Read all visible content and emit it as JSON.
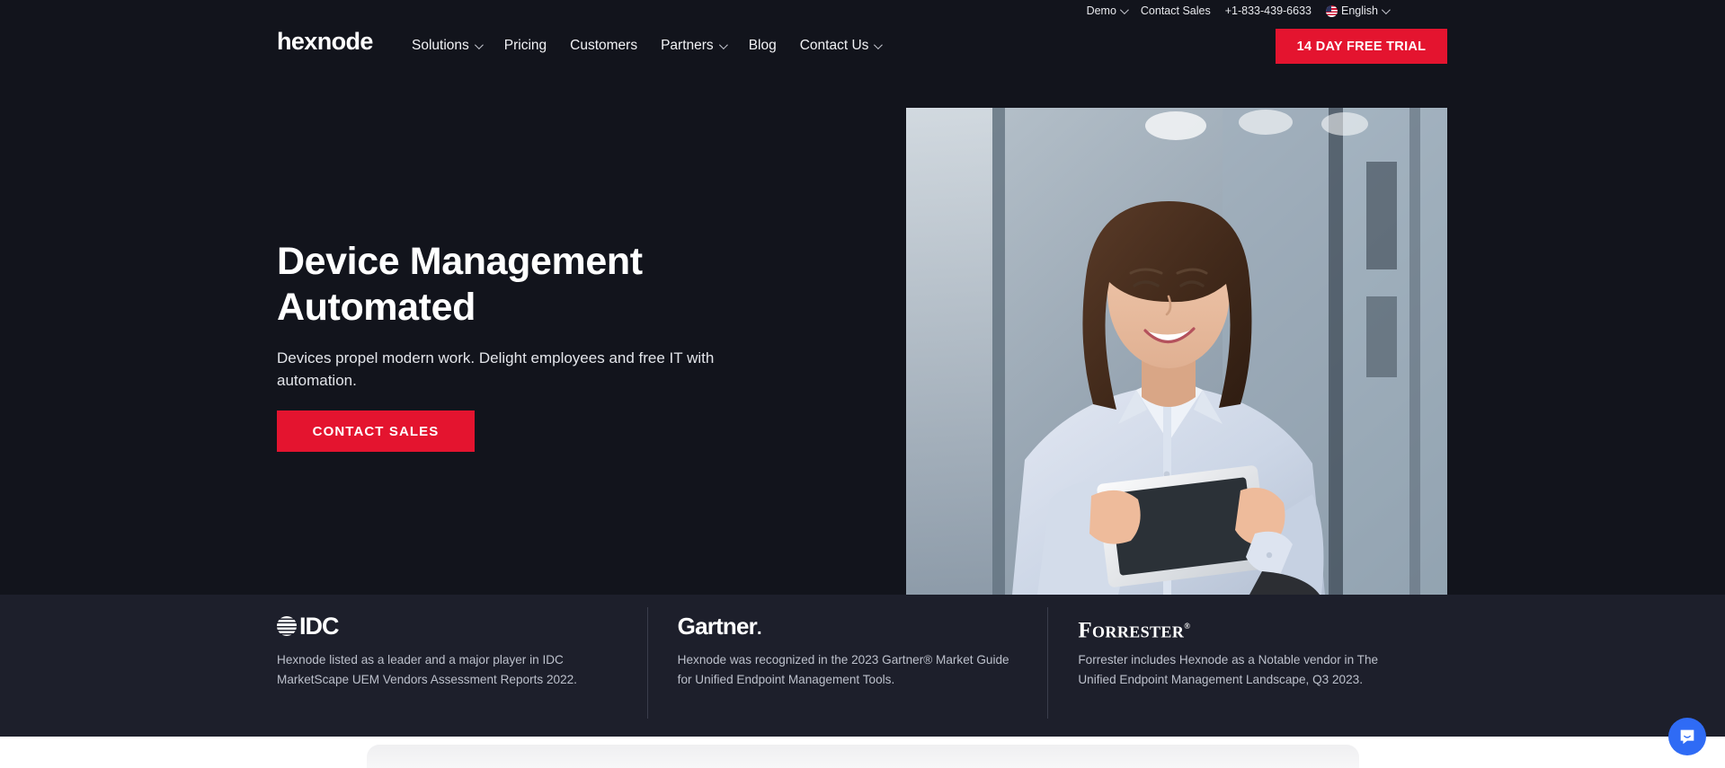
{
  "topbar": {
    "items": [
      {
        "label": "Demo",
        "caret": true,
        "icon": null
      },
      {
        "label": "Contact Sales",
        "caret": false,
        "icon": null
      },
      {
        "label": "+1-833-439-6633",
        "caret": false,
        "icon": null
      },
      {
        "label": "English",
        "caret": true,
        "icon": "us-flag-icon"
      }
    ]
  },
  "brand": {
    "logo_text": "hexnode",
    "accent_color": "#e4142f"
  },
  "nav": {
    "items": [
      {
        "label": "Solutions",
        "caret": true
      },
      {
        "label": "Pricing",
        "caret": false
      },
      {
        "label": "Customers",
        "caret": false
      },
      {
        "label": "Partners",
        "caret": true
      },
      {
        "label": "Blog",
        "caret": false
      },
      {
        "label": "Contact Us",
        "caret": true
      }
    ],
    "trial_button": "14 DAY FREE TRIAL"
  },
  "hero": {
    "heading_line1": "Device Management",
    "heading_line2": "Automated",
    "subheading": "Devices propel modern work. Delight employees and free IT with automation.",
    "cta_label": "CONTACT SALES",
    "image_alt": "smiling-woman-holding-tablet-in-office"
  },
  "analysts": [
    {
      "logo_name": "idc-logo",
      "logo_text": "IDC",
      "text": "Hexnode listed as a leader and a major player in IDC MarketScape UEM Vendors Assessment Reports 2022."
    },
    {
      "logo_name": "gartner-logo",
      "logo_text": "Gartner",
      "text": "Hexnode was recognized in the 2023 Gartner® Market Guide for Unified Endpoint Management Tools."
    },
    {
      "logo_name": "forrester-logo",
      "logo_text": "Forrester",
      "text": "Forrester includes Hexnode as a Notable vendor in The Unified Endpoint Management Landscape, Q3 2023."
    }
  ],
  "chat": {
    "icon": "chat-bubble-icon",
    "color": "#2f6bf5"
  }
}
